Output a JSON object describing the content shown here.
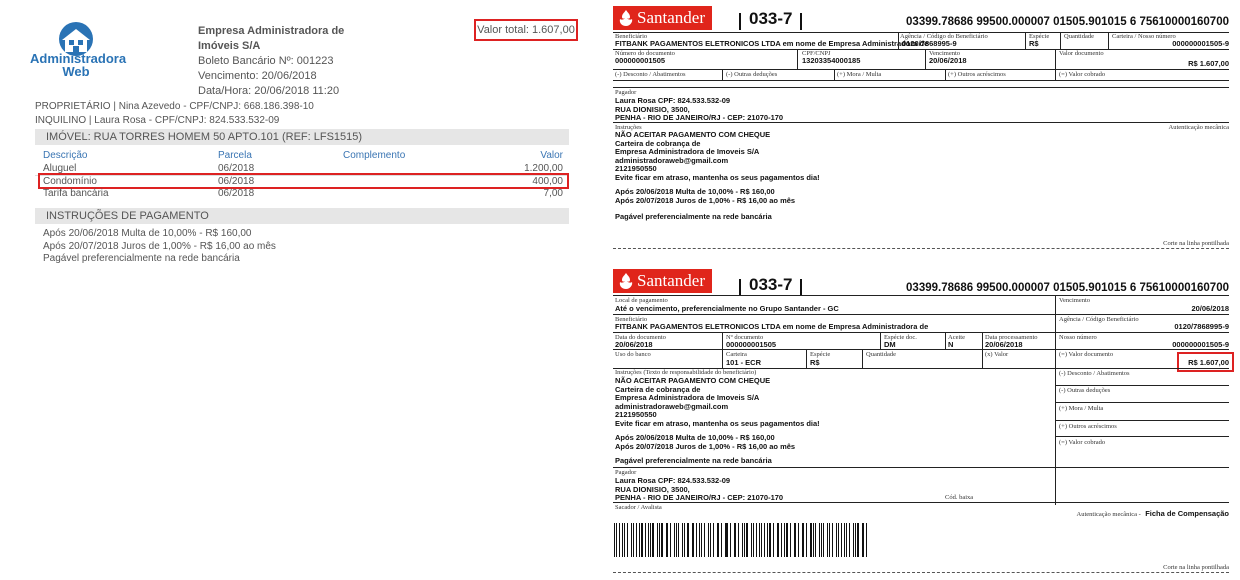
{
  "left": {
    "logo_top": "Administradora",
    "logo_bottom": "Web",
    "company_name_1": "Empresa Administradora de",
    "company_name_2": "Imóveis S/A",
    "boleto_no": "Boleto Bancário Nº: 001223",
    "due": "Vencimento: 20/06/2018",
    "datetime": "Data/Hora: 20/06/2018 11:20",
    "total": "Valor total: 1.607,00",
    "owner": "PROPRIETÁRIO | Nina Azevedo - CPF/CNPJ: 668.186.398-10",
    "tenant": "INQUILINO | Laura Rosa - CPF/CNPJ: 824.533.532-09",
    "property_bar": "IMÓVEL: RUA TORRES HOMEM 50 APTO.101 (REF: LFS1515)",
    "headers": {
      "desc": "Descrição",
      "parcel": "Parcela",
      "comp": "Complemento",
      "value": "Valor"
    },
    "rows": [
      {
        "desc": "Aluguel",
        "parcel": "06/2018",
        "value": "1.200,00"
      },
      {
        "desc": "Condomínio",
        "parcel": "06/2018",
        "value": "400,00"
      },
      {
        "desc": "Tarifa bancária",
        "parcel": "06/2018",
        "value": "7,00"
      }
    ],
    "instructions_bar": "INSTRUÇÕES DE PAGAMENTO",
    "instructions": [
      "Após 20/06/2018 Multa de 10,00% - R$ 160,00",
      "Após 20/07/2018 Juros de 1,00% - R$ 16,00 ao mês",
      "Pagável preferencialmente na rede bancária"
    ]
  },
  "boleto": {
    "bank_name": "Santander",
    "bank_code": "033-7",
    "digitable_line": "03399.78686 99500.000007 01505.901015 6 75610000160700",
    "top": {
      "lbl_benef": "Beneficiário",
      "val_benef": "FITBANK PAGAMENTOS ELETRONICOS LTDA em nome de Empresa Administradora de",
      "lbl_agency": "Agência / Código do Beneficiário",
      "val_agency": "0120/7868995-9",
      "lbl_species": "Espécie",
      "val_species": "R$",
      "lbl_qty": "Quantidade",
      "lbl_carteira": "Carteira / Nosso número",
      "val_carteira": "000000001505-9",
      "lbl_docnum": "Número do documento",
      "val_docnum": "000000001505",
      "lbl_cpf": "CPF/CNPJ",
      "val_cpf": "13203354000185",
      "lbl_venc": "Vencimento",
      "val_venc": "20/06/2018",
      "lbl_valdoc": "Valor documento",
      "val_valdoc": "R$ 1.607,00",
      "lbl_desc": "(-) Desconto / Abatimentos",
      "lbl_outras": "(-) Outras deduções",
      "lbl_mora": "(+) Mora / Multa",
      "lbl_acresc": "(+) Outros acréscimos",
      "lbl_cobrado": "(=) Valor cobrado",
      "lbl_pagador": "Pagador",
      "pagador": [
        "Laura Rosa CPF: 824.533.532-09",
        "RUA DIONISIO, 3500,",
        "PENHA - RIO DE JANEIRO/RJ - CEP: 21070-170"
      ],
      "lbl_instr": "Instruções",
      "lbl_auth": "Autenticação mecânica",
      "instr": [
        "NÃO ACEITAR PAGAMENTO COM CHEQUE",
        "Carteira de cobrança de",
        "Empresa Administradora de Imoveis S/A",
        "administradoraweb@gmail.com",
        "2121950550",
        "Evite ficar em atraso, mantenha os seus pagamentos dia!",
        "",
        "Após 20/06/2018 Multa de 10,00% - R$ 160,00",
        "Após 20/07/2018 Juros de 1,00% - R$ 16,00 ao mês",
        "",
        "Pagável preferencialmente na rede bancária"
      ],
      "cut": "Corte na linha pontilhada"
    },
    "bottom": {
      "lbl_local": "Local de pagamento",
      "val_local": "Até o vencimento, preferencialmente no Grupo Santander - GC",
      "lbl_venc": "Vencimento",
      "val_venc": "20/06/2018",
      "lbl_benef": "Beneficiário",
      "val_benef": "FITBANK PAGAMENTOS ELETRONICOS LTDA em nome de Empresa Administradora de",
      "lbl_agency": "Agência / Código Beneficiário",
      "val_agency": "0120/7868995-9",
      "lbl_datadoc": "Data do documento",
      "val_datadoc": "20/06/2018",
      "lbl_ndoc": "Nº documento",
      "val_ndoc": "000000001505",
      "lbl_espdoc": "Espécie doc.",
      "val_espdoc": "DM",
      "lbl_aceite": "Aceite",
      "val_aceite": "N",
      "lbl_dataproc": "Data processamento",
      "val_dataproc": "20/06/2018",
      "lbl_nosso": "Nosso número",
      "val_nosso": "000000001505-9",
      "lbl_uso": "Uso do banco",
      "lbl_carteira": "Carteira",
      "val_carteira": "101 - ECR",
      "lbl_especie": "Espécie",
      "val_especie": "R$",
      "lbl_qty": "Quantidade",
      "lbl_xvalor": "(x) Valor",
      "lbl_valdoc": "(=) Valor documento",
      "val_valdoc": "R$ 1.607,00",
      "lbl_instr": "Instruções (Texto de responsabilidade do beneficiário)",
      "instr": [
        "NÃO ACEITAR PAGAMENTO COM CHEQUE",
        "Carteira de cobrança de",
        "Empresa Administradora de Imoveis S/A",
        "administradoraweb@gmail.com",
        "2121950550",
        "Evite ficar em atraso, mantenha os seus pagamentos dia!",
        "",
        "Após 20/06/2018 Multa de 10,00% - R$ 160,00",
        "Após 20/07/2018 Juros de 1,00% - R$ 16,00 ao mês",
        "",
        "Pagável preferencialmente na rede bancária"
      ],
      "right_labels": [
        "(-) Desconto / Abatimentos",
        "(-) Outras deduções",
        "(+) Mora / Multa",
        "(+) Outros acréscimos",
        "(=) Valor cobrado"
      ],
      "lbl_pagador": "Pagador",
      "pagador": [
        "Laura Rosa CPF: 824.533.532-09",
        "RUA DIONISIO, 3500,",
        "PENHA - RIO DE JANEIRO/RJ - CEP: 21070-170"
      ],
      "lbl_codbaixa": "Cód. baixa",
      "lbl_sacador": "Sacador / Avalista",
      "lbl_auth": "Autenticação mecânica -",
      "ficha": "Ficha de Compensação",
      "cut": "Corte na linha pontilhada"
    }
  }
}
